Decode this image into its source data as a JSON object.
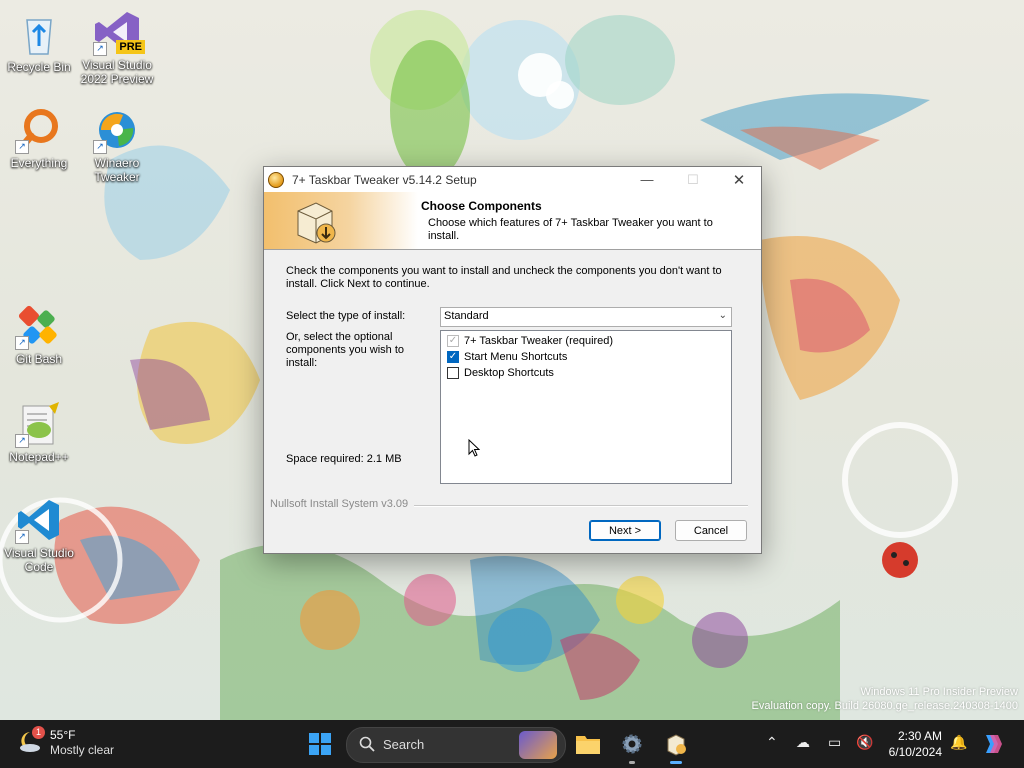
{
  "desktop": {
    "icons": [
      {
        "label": "Recycle Bin"
      },
      {
        "label": "Visual Studio 2022 Preview",
        "badge": "PRE"
      },
      {
        "label": "Everything"
      },
      {
        "label": "Winaero Tweaker"
      },
      {
        "label": "Git Bash"
      },
      {
        "label": "Notepad++"
      },
      {
        "label": "Visual Studio Code"
      }
    ],
    "watermark_line1": "Windows 11 Pro Insider Preview",
    "watermark_line2": "Evaluation copy. Build 26080.ge_release.240308-1400"
  },
  "dialog": {
    "title": "7+ Taskbar Tweaker v5.14.2 Setup",
    "header_title": "Choose Components",
    "header_subtitle": "Choose which features of 7+ Taskbar Tweaker you want to install.",
    "intro": "Check the components you want to install and uncheck the components you don't want to install. Click Next to continue.",
    "install_type_label": "Select the type of install:",
    "install_type_value": "Standard",
    "optional_label": "Or, select the optional components you wish to install:",
    "components": [
      {
        "label": "7+ Taskbar Tweaker (required)",
        "checked": true,
        "disabled": true
      },
      {
        "label": "Start Menu Shortcuts",
        "checked": true,
        "disabled": false
      },
      {
        "label": "Desktop Shortcuts",
        "checked": false,
        "disabled": false
      }
    ],
    "space_required": "Space required: 2.1 MB",
    "branding": "Nullsoft Install System v3.09",
    "next_label": "Next >",
    "cancel_label": "Cancel"
  },
  "taskbar": {
    "weather_temp": "55°F",
    "weather_desc": "Mostly clear",
    "weather_badge": "1",
    "search_placeholder": "Search",
    "time": "2:30 AM",
    "date": "6/10/2024"
  },
  "colors": {
    "accent": "#0067c0",
    "taskbar": "#1c1c1c"
  }
}
